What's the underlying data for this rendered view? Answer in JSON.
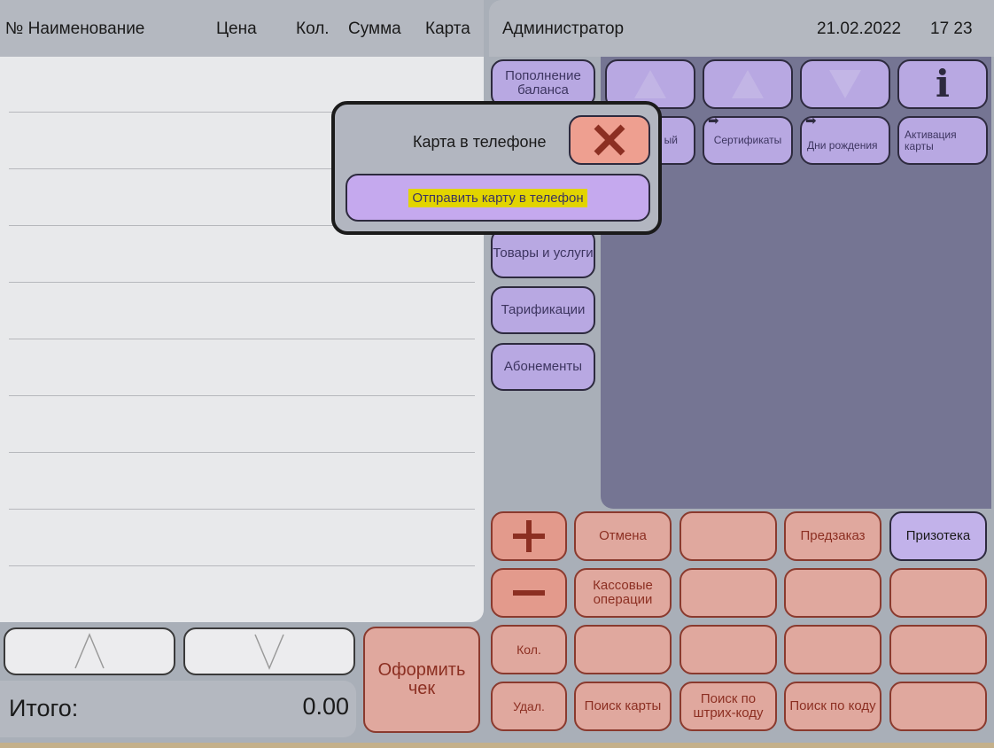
{
  "receipt": {
    "columns": {
      "number_name": "№ Наименование",
      "price": "Цена",
      "qty": "Кол.",
      "sum": "Сумма",
      "card": "Карта"
    },
    "total_label": "Итого:",
    "total_value": "0.00"
  },
  "header": {
    "user": "Администратор",
    "date": "21.02.2022",
    "time": "17 23"
  },
  "categories": {
    "topup": "Пополнение баланса",
    "goods": "Товары и услуги",
    "tariffs": "Тарификации",
    "subscriptions": "Абонементы"
  },
  "grid": {
    "info_glyph": "i",
    "items": {
      "partial": "ый",
      "certificates": "Сертификаты",
      "birthdays": "Дни рождения",
      "card_activation": "Активация карты"
    }
  },
  "actions": {
    "cancel": "Отмена",
    "preorder": "Предзаказ",
    "prizoteka": "Призотека",
    "cash_operations": "Кассовые операции",
    "qty": "Кол.",
    "delete": "Удал.",
    "search_card": "Поиск карты",
    "search_barcode": "Поиск по штрих-коду",
    "search_code": "Поиск по коду",
    "checkout": "Оформить чек"
  },
  "modal": {
    "title": "Карта в телефоне",
    "send_button": "Отправить карту в телефон"
  },
  "colors": {
    "accent_purple": "#b8a8e2",
    "accent_red": "#e0a89e",
    "grid_panel": "#757593"
  },
  "icons": {
    "close": "close-icon",
    "plus": "plus-icon",
    "minus": "minus-icon",
    "info": "info-icon",
    "up": "chevron-up-icon",
    "down": "chevron-down-icon",
    "forward": "arrow-right-icon"
  }
}
